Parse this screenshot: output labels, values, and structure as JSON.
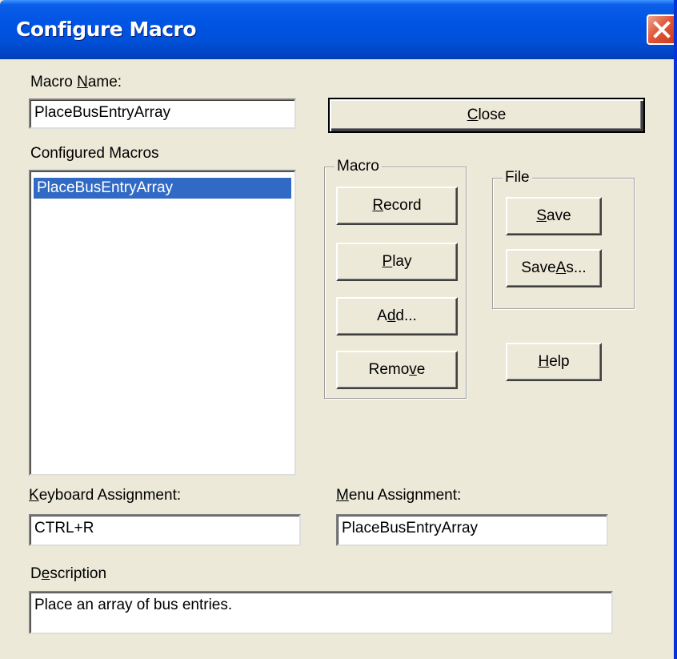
{
  "window": {
    "title": "Configure Macro",
    "close_icon": "close-icon"
  },
  "macro_name": {
    "label_pre": "Macro ",
    "label_u": "N",
    "label_post": "ame:",
    "value": "PlaceBusEntryArray"
  },
  "configured_macros": {
    "label": "Configured Macros",
    "items": [
      "PlaceBusEntryArray"
    ]
  },
  "buttons": {
    "close": {
      "u": "C",
      "rest": "lose"
    },
    "record": {
      "u": "R",
      "rest": "ecord"
    },
    "play": {
      "u": "P",
      "rest": "lay"
    },
    "add": {
      "pre": "A",
      "u": "d",
      "rest": "d..."
    },
    "remove": {
      "pre": "Remo",
      "u": "v",
      "rest": "e"
    },
    "save": {
      "u": "S",
      "rest": "ave"
    },
    "save_as": {
      "pre": "Save ",
      "u": "A",
      "rest": "s..."
    },
    "help": {
      "u": "H",
      "rest": "elp"
    }
  },
  "groups": {
    "macro_label": "Macro",
    "file_label": "File"
  },
  "keyboard_assignment": {
    "label_u": "K",
    "label_rest": "eyboard Assignment:",
    "value": "CTRL+R"
  },
  "menu_assignment": {
    "label_u": "M",
    "label_rest": "enu Assignment:",
    "value": "PlaceBusEntryArray"
  },
  "description": {
    "label_pre": "D",
    "label_u": "e",
    "label_rest": "scription",
    "value": "Place an array of bus entries."
  },
  "colors": {
    "titlebar": "#0054e3",
    "face": "#ece9d8",
    "selection": "#316ac5",
    "close_button": "#e0573a"
  }
}
